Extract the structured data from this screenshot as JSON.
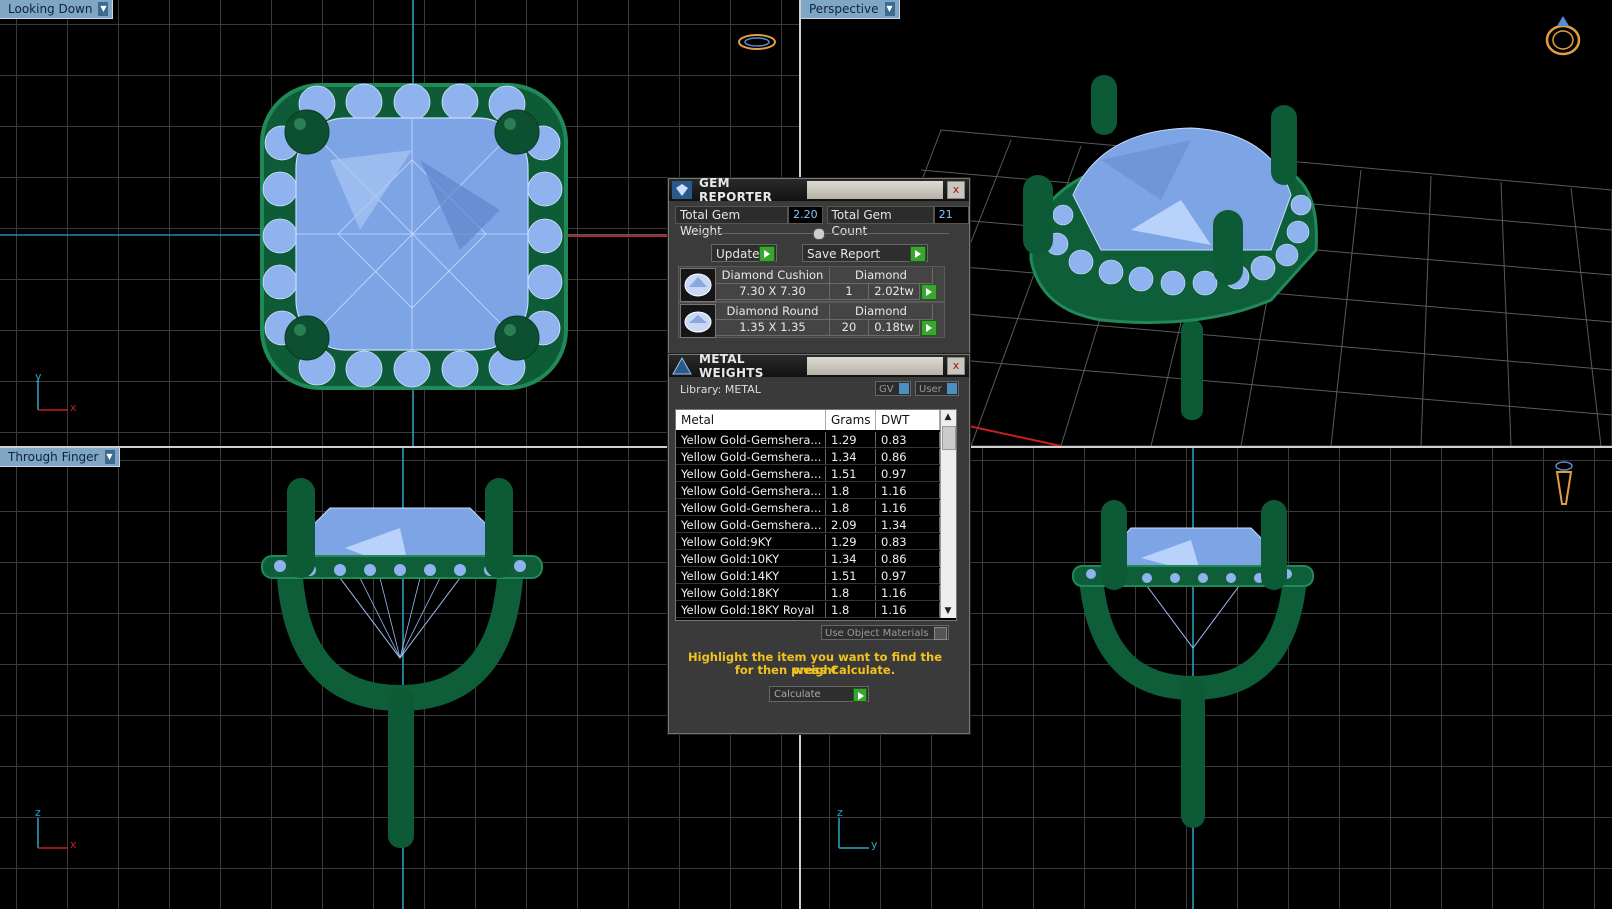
{
  "viewports": {
    "top_left": {
      "label": "Looking Down",
      "axis_v": "y",
      "axis_h": "x"
    },
    "top_right": {
      "label": "Perspective"
    },
    "bottom_left": {
      "label": "Through Finger",
      "axis_v": "z",
      "axis_h": "x"
    },
    "bottom_right": {
      "axis_v": "z",
      "axis_h": "y"
    }
  },
  "gem_reporter": {
    "title": "GEM REPORTER",
    "close": "x",
    "total_weight_label": "Total Gem Weight",
    "total_weight_value": "2.20",
    "total_count_label": "Total Gem Count",
    "total_count_value": "21",
    "update_label": "Update",
    "save_report_label": "Save Report",
    "gems": [
      {
        "name": "Diamond Cushion",
        "size": "7.30 X 7.30",
        "material": "Diamond",
        "count": "1",
        "weight": "2.02tw"
      },
      {
        "name": "Diamond Round",
        "size": "1.35 X 1.35",
        "material": "Diamond",
        "count": "20",
        "weight": "0.18tw"
      }
    ]
  },
  "metal_weights": {
    "title": "METAL WEIGHTS",
    "close": "x",
    "library_label": "Library: METAL",
    "gv_label": "GV",
    "user_label": "User",
    "columns": [
      "Metal",
      "Grams",
      "DWT"
    ],
    "rows": [
      [
        "Yellow Gold-Gemshera...",
        "1.29",
        "0.83"
      ],
      [
        "Yellow Gold-Gemshera...",
        "1.34",
        "0.86"
      ],
      [
        "Yellow Gold-Gemshera...",
        "1.51",
        "0.97"
      ],
      [
        "Yellow Gold-Gemshera...",
        "1.8",
        "1.16"
      ],
      [
        "Yellow Gold-Gemshera...",
        "1.8",
        "1.16"
      ],
      [
        "Yellow Gold-Gemshera...",
        "2.09",
        "1.34"
      ],
      [
        "Yellow Gold:9KY",
        "1.29",
        "0.83"
      ],
      [
        "Yellow Gold:10KY",
        "1.34",
        "0.86"
      ],
      [
        "Yellow Gold:14KY",
        "1.51",
        "0.97"
      ],
      [
        "Yellow Gold:18KY",
        "1.8",
        "1.16"
      ],
      [
        "Yellow Gold:18KY Royal",
        "1.8",
        "1.16"
      ]
    ],
    "use_object_materials_label": "Use Object Materials",
    "hint_line1": "Highlight the item you want to find the weight",
    "hint_line2": "for then press Calculate.",
    "calculate_label": "Calculate"
  },
  "colors": {
    "metal_green": "#0f5e3a",
    "gem_blue": "#7fa6e6",
    "grid": "#3a3a3a",
    "axis_cyan": "#2ea6c8",
    "accent_yellow": "#f2c21f",
    "viewport_label_bg": "#7fa6c4"
  }
}
